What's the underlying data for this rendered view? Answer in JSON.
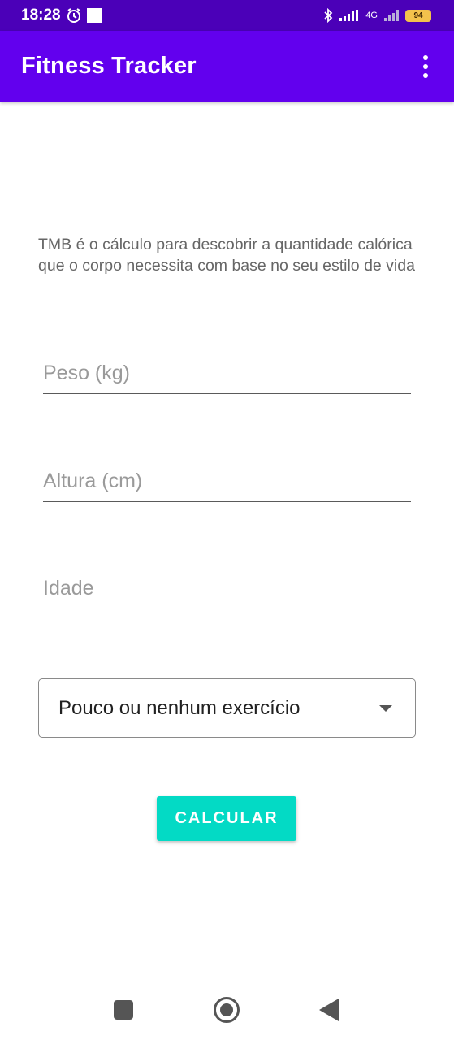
{
  "status_bar": {
    "time": "18:28",
    "alarm_icon": "alarm-clock-icon",
    "notification_icon": "square-icon",
    "bluetooth_icon": "bluetooth-icon",
    "signal_icon": "signal-bars-icon",
    "network_label": "4G",
    "battery_level": "94"
  },
  "app_bar": {
    "title": "Fitness Tracker",
    "overflow_icon": "more-vert-icon",
    "background_color": "#6200ee"
  },
  "description": "TMB é o cálculo para descobrir a quantidade calórica que o corpo necessita com base no seu estilo de vida",
  "form": {
    "weight_placeholder": "Peso (kg)",
    "weight_value": "",
    "height_placeholder": "Altura (cm)",
    "height_value": "",
    "age_placeholder": "Idade",
    "age_value": "",
    "activity_selected": "Pouco ou nenhum exercício",
    "calculate_label": "CALCULAR",
    "button_color": "#03dac5"
  },
  "nav_bar": {
    "recents_icon": "square-recents-icon",
    "home_icon": "circle-home-icon",
    "back_icon": "triangle-back-icon"
  }
}
